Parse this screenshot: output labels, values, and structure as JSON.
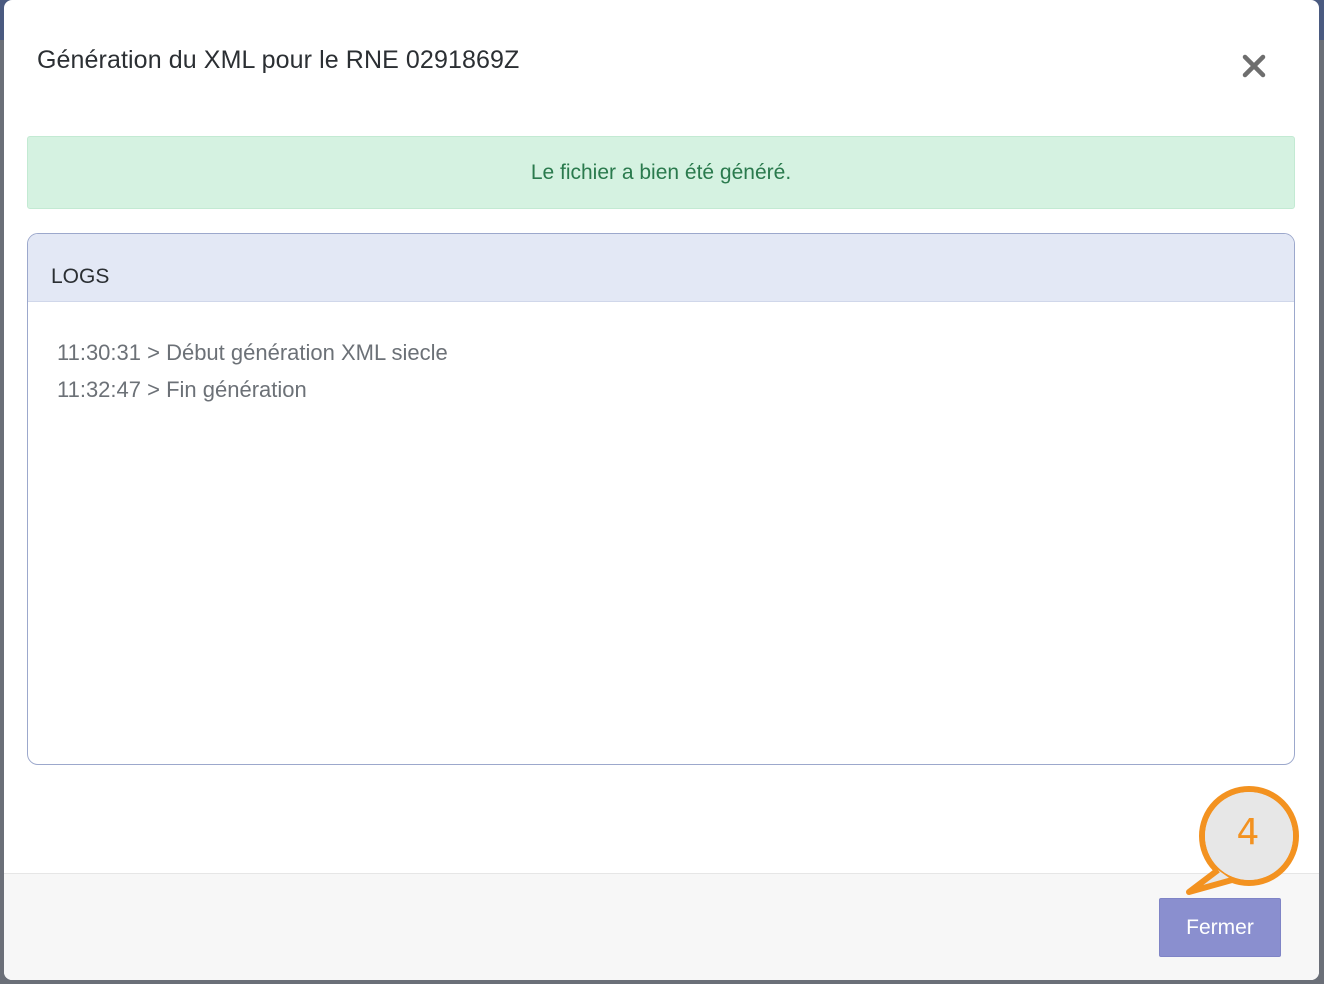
{
  "dialog": {
    "title": "Génération du XML pour le RNE 0291869Z",
    "close_icon": "close-icon"
  },
  "alert": {
    "message": "Le fichier a bien été généré.",
    "color": "#2a7a4d",
    "background": "#d5f2e1"
  },
  "logs": {
    "header": "LOGS",
    "entries": [
      "11:30:31 > Début génération XML siecle",
      "11:32:47 > Fin génération"
    ]
  },
  "footer": {
    "close_label": "Fermer",
    "button_color": "#8a8fcf"
  },
  "annotation": {
    "step_number": "4",
    "color": "#f39220"
  }
}
